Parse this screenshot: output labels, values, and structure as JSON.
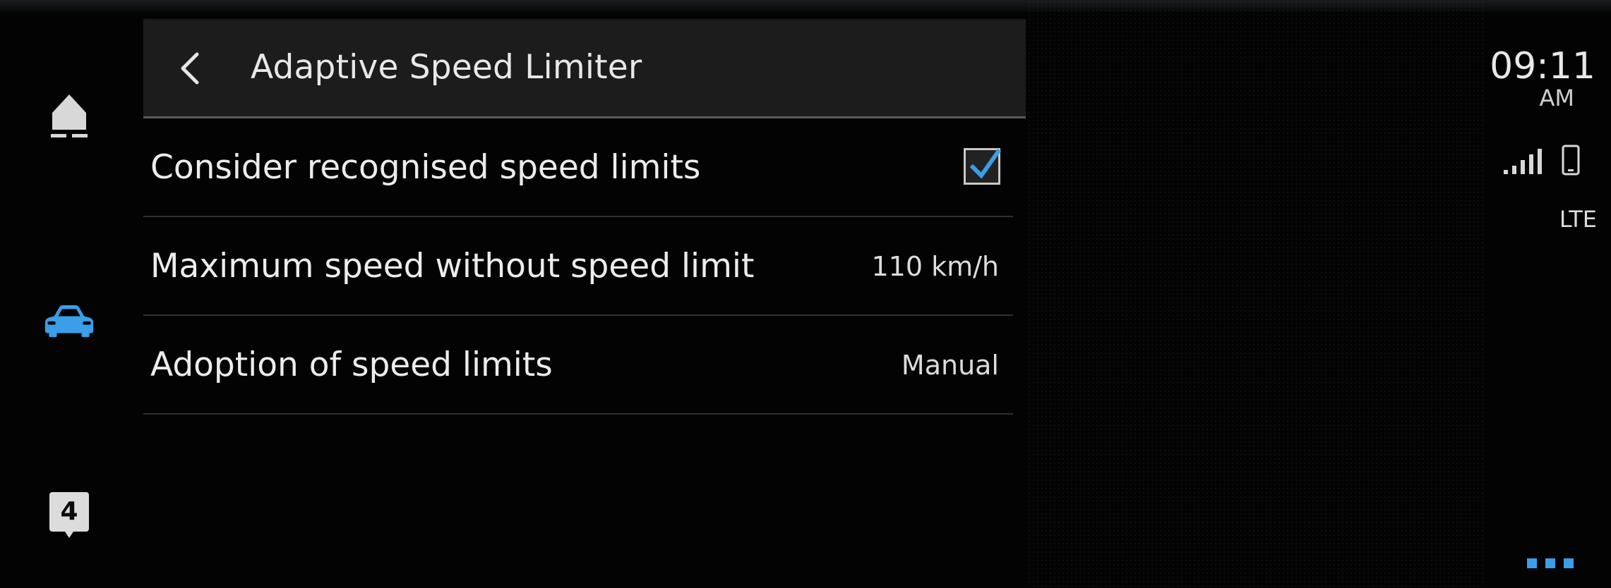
{
  "header": {
    "title": "Adaptive Speed Limiter",
    "back_icon": "chevron-left-icon"
  },
  "settings": [
    {
      "label": "Consider recognised speed limits",
      "type": "checkbox",
      "checked": true
    },
    {
      "label": "Maximum speed without speed limit",
      "type": "value",
      "value": "110 km/h"
    },
    {
      "label": "Adoption of speed limits",
      "type": "value",
      "value": "Manual"
    }
  ],
  "rail": {
    "home_icon": "home-icon",
    "car_icon": "car-icon",
    "notification_count": "4"
  },
  "status": {
    "time": "09:11",
    "ampm": "AM",
    "network": "LTE",
    "signal_icon": "signal-bars-icon",
    "phone_icon": "phone-icon"
  },
  "colors": {
    "accent": "#3a9ee8",
    "background": "#030303",
    "header_bg": "#1c1c1c"
  }
}
